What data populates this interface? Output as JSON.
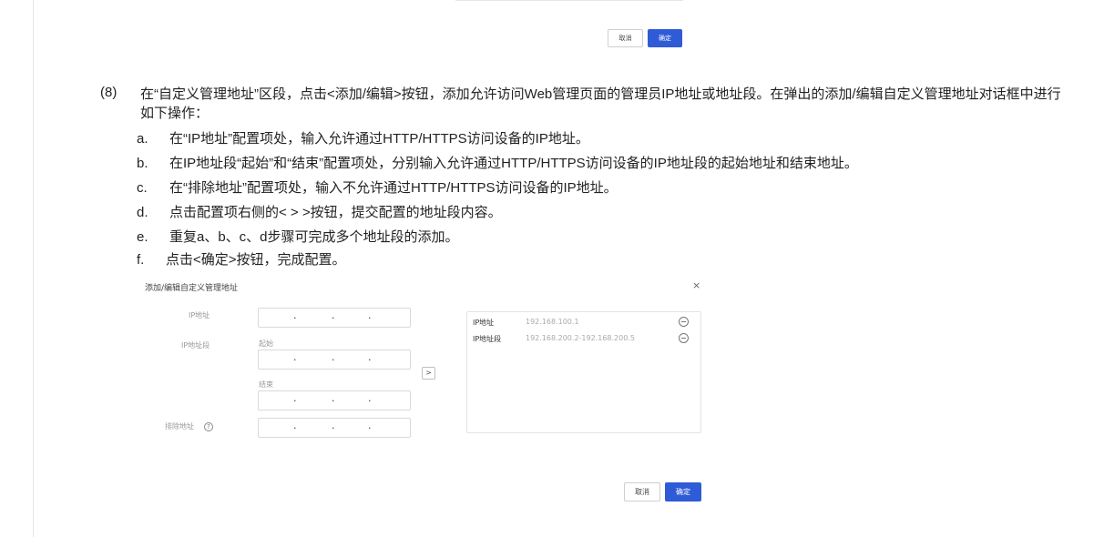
{
  "top_dialog": {
    "cancel_label": "取消",
    "ok_label": "确定"
  },
  "doc": {
    "step_number": "(8)",
    "step_text": "在“自定义管理地址”区段，点击<添加/编辑>按钮，添加允许访问Web管理页面的管理员IP地址或地址段。在弹出的添加/编辑自定义管理地址对话框中进行如下操作：",
    "substeps": [
      {
        "letter": "a.",
        "text": "在“IP地址”配置项处，输入允许通过HTTP/HTTPS访问设备的IP地址。"
      },
      {
        "letter": "b.",
        "text": "在IP地址段“起始”和“结束”配置项处，分别输入允许通过HTTP/HTTPS访问设备的IP地址段的起始地址和结束地址。"
      },
      {
        "letter": "c.",
        "text": "在“排除地址”配置项处，输入不允许通过HTTP/HTTPS访问设备的IP地址。"
      },
      {
        "letter": "d.",
        "text": "点击配置项右侧的< > >按钮，提交配置的地址段内容。"
      },
      {
        "letter": "e.",
        "text": "重复a、b、c、d步骤可完成多个地址段的添加。"
      },
      {
        "letter": "f.",
        "text": "点击<确定>按钮，完成配置。"
      }
    ]
  },
  "dialog": {
    "title": "添加/编辑自定义管理地址",
    "close_glyph": "×",
    "ip_label": "IP地址",
    "range_label": "IP地址段",
    "start_label": "起始",
    "end_label": "结束",
    "exclude_label": "排除地址",
    "help_glyph": "?",
    "arrow_glyph": ">",
    "ip_separator": "·",
    "list": [
      {
        "key": "IP地址",
        "value": "192.168.100.1"
      },
      {
        "key": "IP地址段",
        "value": "192.168.200.2-192.168.200.5"
      }
    ],
    "cancel_label": "取消",
    "ok_label": "确定"
  }
}
